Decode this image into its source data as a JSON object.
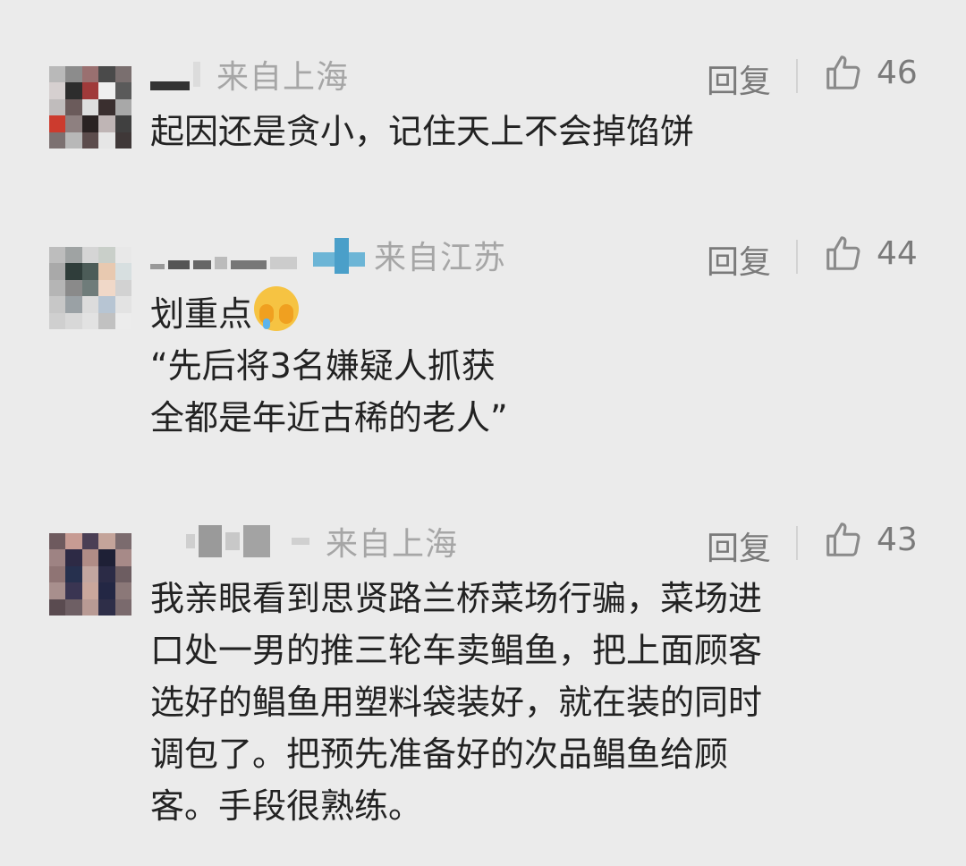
{
  "comments": [
    {
      "location": "来自上海",
      "reply_label": "回复",
      "likes": "46",
      "lines": [
        "起因还是贪小，记住天上不会掉馅饼"
      ],
      "avatar_colors": [
        "#b9b9b9",
        "#8c8c8c",
        "#9a7070",
        "#4a4a4a",
        "#7a6f6f",
        "#d6d0d0",
        "#2d2d2d",
        "#a03a3a",
        "#efefef",
        "#5a5a5a",
        "#c0bcbc",
        "#6b5b5b",
        "#dedede",
        "#3a2f2f",
        "#a8a8a8",
        "#cc3b2e",
        "#8e8080",
        "#2a2222",
        "#bfb5b5",
        "#404040",
        "#7c7171",
        "#b8b8b8",
        "#5c4c4c",
        "#e6e6e6",
        "#3f3838"
      ]
    },
    {
      "location": "来自江苏",
      "reply_label": "回复",
      "likes": "44",
      "lines": [
        "划重点",
        "“先后将3名嫌疑人抓获",
        "全都是年近古稀的老人”"
      ],
      "avatar_colors": [
        "#bdbdbd",
        "#9fa3a3",
        "#d5d5d5",
        "#c9cfc9",
        "#e8e8e8",
        "#a9a9a9",
        "#2f3d3a",
        "#4c5c58",
        "#e8c9b0",
        "#d7dfe0",
        "#b5b5b5",
        "#8a8a8a",
        "#6f7c7a",
        "#f0d8c8",
        "#d2d2d2",
        "#c7c7c7",
        "#9aa1a5",
        "#dcdcdc",
        "#b7c5d3",
        "#e3e3e3",
        "#cfcfcf",
        "#d8d8d8",
        "#e2e2e2",
        "#c1c1c1",
        "#ececec"
      ]
    },
    {
      "location": "来自上海",
      "reply_label": "回复",
      "likes": "43",
      "lines": [
        "我亲眼看到思贤路兰桥菜场行骗，菜场进",
        "口处一男的推三轮车卖鲳鱼，把上面顾客",
        "选好的鲳鱼用塑料袋装好，就在装的同时",
        "调包了。把预先准备好的次品鲳鱼给顾",
        "客。手段很熟练。"
      ],
      "avatar_colors": [
        "#6e5a5e",
        "#c79b93",
        "#4b3f55",
        "#c4a49a",
        "#7b6b6e",
        "#9e8383",
        "#2d2a45",
        "#b08c86",
        "#1e2036",
        "#a78a88",
        "#8f7474",
        "#26304e",
        "#c2a6a0",
        "#2b2b46",
        "#6d5d61",
        "#a88f8d",
        "#3a3552",
        "#caa79c",
        "#232744",
        "#8b7878",
        "#5a4b50",
        "#6e5f64",
        "#b89a94",
        "#2e2e48",
        "#7a6a6d"
      ]
    }
  ]
}
